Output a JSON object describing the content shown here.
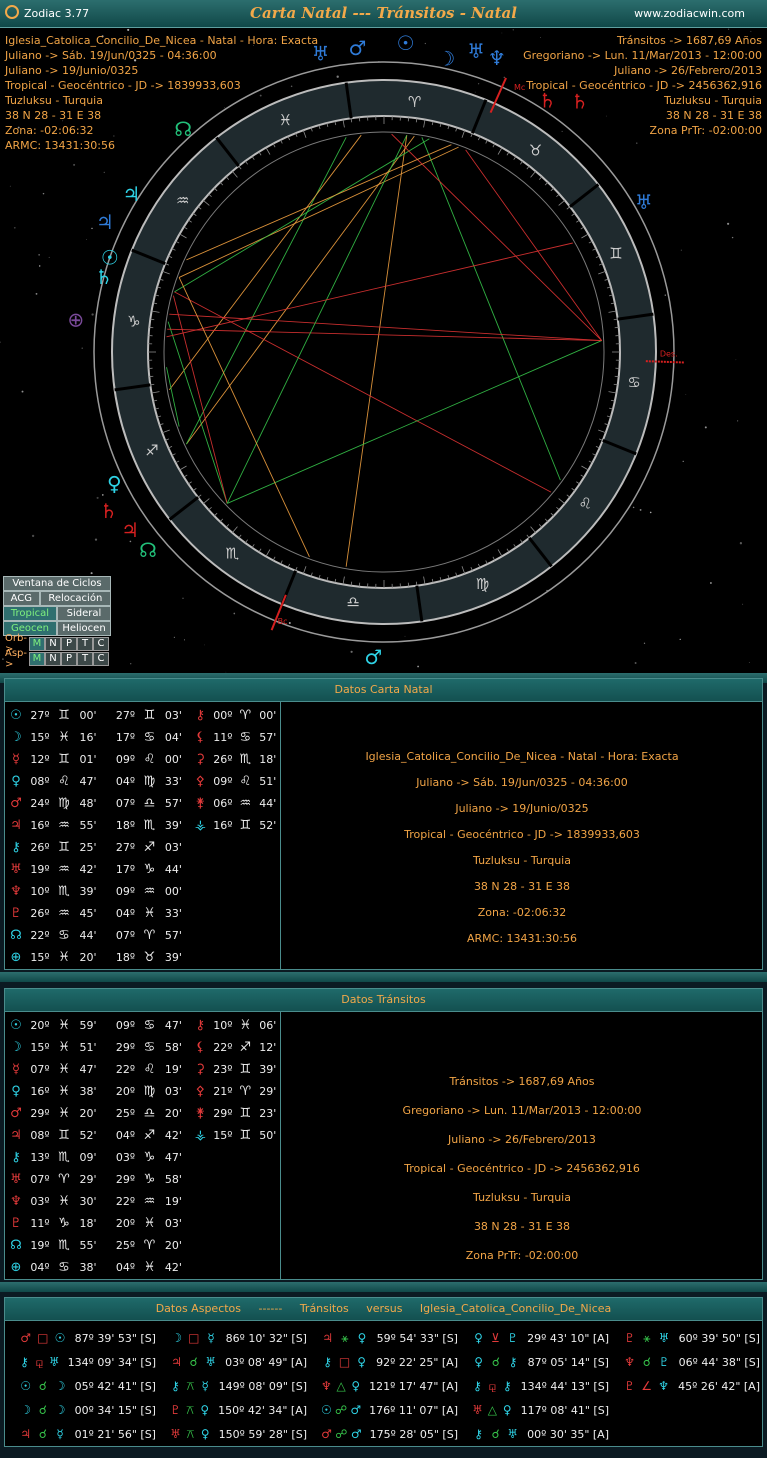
{
  "window": {
    "app_name": "Zodiac 3.77",
    "title": "Carta Natal --- Tránsitos - Natal",
    "website": "www.zodiacwin.com"
  },
  "natal_header": [
    "Iglesia_Catolica_Concilio_De_Nicea - Natal - Hora: Exacta",
    "Juliano -> Sáb. 19/Jun/0325 - 04:36:00",
    "Juliano -> 19/Junio/0325",
    "Tropical - Geocéntrico - JD -> 1839933,603",
    "Tuzluksu - Turquia",
    "38 N 28 - 31 E 38",
    "Zona: -02:06:32",
    "ARMC: 13431:30:56"
  ],
  "transit_header": [
    "Tránsitos -> 1687,69 Años",
    "Gregoriano -> Lun. 11/Mar/2013 - 12:00:00",
    "Juliano -> 26/Febrero/2013",
    "Tropical - Geocéntrico - JD -> 2456362,916",
    "Tuzluksu - Turquia",
    "38 N 28 - 31 E 38",
    "Zona PrTr: -02:00:00"
  ],
  "wheel": {
    "signs": [
      "♈",
      "♉",
      "♊",
      "♋",
      "♌",
      "♍",
      "♎",
      "♏",
      "♐",
      "♑",
      "♒",
      "♓"
    ],
    "angle_labels": {
      "mc": "Mc",
      "des": "Des.",
      "bc": "Bc"
    },
    "colors": {
      "sign_ring": "#1f2a2e",
      "ring_stroke": "#bcbcbc",
      "natal_planet": "#2fd3e6",
      "transit_planet": "#d62020",
      "blue_planet": "#2f7bd8",
      "green_planet": "#22c07a"
    },
    "transit_glyphs": [
      "♅",
      "♆",
      "♄",
      "☿",
      "♀",
      "♂",
      "☽",
      "⊕"
    ],
    "natal_glyphs": [
      "♃",
      "♅",
      "♄",
      "☉",
      "♌",
      "☊",
      "♀",
      "♆",
      "♄",
      "☊",
      "♂",
      "☽"
    ]
  },
  "controls": {
    "ventana": "Ventana de Ciclos",
    "acg": "ACG",
    "relocacion": "Relocación",
    "tropical": "Tropical",
    "sideral": "Sideral",
    "geocen": "Geocen",
    "heliocen": "Heliocen",
    "orb_label": "Orb->",
    "asp_label": "Asp->",
    "letters": [
      "M",
      "N",
      "P",
      "T",
      "C"
    ]
  },
  "natal_panel": {
    "title": "Datos Carta Natal",
    "rows": [
      [
        [
          "☉",
          "27º",
          "♊",
          "00'"
        ],
        [
          "",
          "27º",
          "♊",
          "03'"
        ],
        [
          "⚷",
          "00º",
          "♈",
          "00'"
        ]
      ],
      [
        [
          "☽",
          "15º",
          "♓",
          "16'"
        ],
        [
          "",
          "17º",
          "♋",
          "04'"
        ],
        [
          "⚸",
          "11º",
          "♋",
          "57'"
        ]
      ],
      [
        [
          "☿",
          "12º",
          "♊",
          "01'"
        ],
        [
          "",
          "09º",
          "♌",
          "00'"
        ],
        [
          "⚳",
          "26º",
          "♏",
          "18'"
        ]
      ],
      [
        [
          "♀",
          "08º",
          "♌",
          "47'"
        ],
        [
          "",
          "04º",
          "♍",
          "33'"
        ],
        [
          "⚴",
          "09º",
          "♌",
          "51'"
        ]
      ],
      [
        [
          "♂",
          "24º",
          "♍",
          "48'"
        ],
        [
          "",
          "07º",
          "♎",
          "57'"
        ],
        [
          "⚵",
          "06º",
          "♒",
          "44'"
        ]
      ],
      [
        [
          "♃",
          "16º",
          "♒",
          "55'"
        ],
        [
          "",
          "18º",
          "♏",
          "39'"
        ],
        [
          "⚶",
          "16º",
          "♊",
          "52'"
        ]
      ],
      [
        [
          "⚷",
          "26º",
          "♊",
          "25'"
        ],
        [
          "",
          "27º",
          "♐",
          "03'"
        ],
        [
          "",
          "",
          "",
          ""
        ]
      ],
      [
        [
          "♅",
          "19º",
          "♒",
          "42'"
        ],
        [
          "",
          "17º",
          "♑",
          "44'"
        ],
        [
          "",
          "",
          "",
          ""
        ]
      ],
      [
        [
          "♆",
          "10º",
          "♏",
          "39'"
        ],
        [
          "",
          "09º",
          "♒",
          "00'"
        ],
        [
          "",
          "",
          "",
          ""
        ]
      ],
      [
        [
          "♇",
          "26º",
          "♒",
          "45'"
        ],
        [
          "",
          "04º",
          "♓",
          "33'"
        ],
        [
          "",
          "",
          "",
          ""
        ]
      ],
      [
        [
          "☊",
          "22º",
          "♋",
          "44'"
        ],
        [
          "",
          "07º",
          "♈",
          "57'"
        ],
        [
          "",
          "",
          "",
          ""
        ]
      ],
      [
        [
          "⊕",
          "15º",
          "♓",
          "20'"
        ],
        [
          "",
          "18º",
          "♉",
          "39'"
        ],
        [
          "",
          "",
          "",
          ""
        ]
      ]
    ],
    "info": [
      "Iglesia_Catolica_Concilio_De_Nicea - Natal - Hora: Exacta",
      "Juliano -> Sáb. 19/Jun/0325 - 04:36:00",
      "Juliano -> 19/Junio/0325",
      "Tropical - Geocéntrico - JD -> 1839933,603",
      "Tuzluksu - Turquia",
      "38 N 28 - 31 E 38",
      "Zona: -02:06:32",
      "ARMC: 13431:30:56"
    ]
  },
  "transit_panel": {
    "title": "Datos Tránsitos",
    "rows": [
      [
        [
          "☉",
          "20º",
          "♓",
          "59'"
        ],
        [
          "",
          "09º",
          "♋",
          "47'"
        ],
        [
          "⚷",
          "10º",
          "♓",
          "06'"
        ]
      ],
      [
        [
          "☽",
          "15º",
          "♓",
          "51'"
        ],
        [
          "",
          "29º",
          "♋",
          "58'"
        ],
        [
          "⚸",
          "22º",
          "♐",
          "12'"
        ]
      ],
      [
        [
          "☿",
          "07º",
          "♓",
          "47'"
        ],
        [
          "",
          "22º",
          "♌",
          "19'"
        ],
        [
          "⚳",
          "23º",
          "♊",
          "39'"
        ]
      ],
      [
        [
          "♀",
          "16º",
          "♓",
          "38'"
        ],
        [
          "",
          "20º",
          "♍",
          "03'"
        ],
        [
          "⚴",
          "21º",
          "♈",
          "29'"
        ]
      ],
      [
        [
          "♂",
          "29º",
          "♓",
          "20'"
        ],
        [
          "",
          "25º",
          "♎",
          "20'"
        ],
        [
          "⚵",
          "29º",
          "♊",
          "23'"
        ]
      ],
      [
        [
          "♃",
          "08º",
          "♊",
          "52'"
        ],
        [
          "",
          "04º",
          "♐",
          "42'"
        ],
        [
          "⚶",
          "15º",
          "♊",
          "50'"
        ]
      ],
      [
        [
          "⚷",
          "13º",
          "♏",
          "09'"
        ],
        [
          "",
          "03º",
          "♑",
          "47'"
        ],
        [
          "",
          "",
          "",
          ""
        ]
      ],
      [
        [
          "♅",
          "07º",
          "♈",
          "29'"
        ],
        [
          "",
          "29º",
          "♑",
          "58'"
        ],
        [
          "",
          "",
          "",
          ""
        ]
      ],
      [
        [
          "♆",
          "03º",
          "♓",
          "30'"
        ],
        [
          "",
          "22º",
          "♒",
          "19'"
        ],
        [
          "",
          "",
          "",
          ""
        ]
      ],
      [
        [
          "♇",
          "11º",
          "♑",
          "18'"
        ],
        [
          "",
          "20º",
          "♓",
          "03'"
        ],
        [
          "",
          "",
          "",
          ""
        ]
      ],
      [
        [
          "☊",
          "19º",
          "♏",
          "55'"
        ],
        [
          "",
          "25º",
          "♈",
          "20'"
        ],
        [
          "",
          "",
          "",
          ""
        ]
      ],
      [
        [
          "⊕",
          "04º",
          "♋",
          "38'"
        ],
        [
          "",
          "04º",
          "♓",
          "42'"
        ],
        [
          "",
          "",
          "",
          ""
        ]
      ]
    ],
    "info": [
      "Tránsitos -> 1687,69 Años",
      "Gregoriano -> Lun. 11/Mar/2013 - 12:00:00",
      "Juliano -> 26/Febrero/2013",
      "Tropical - Geocéntrico - JD -> 2456362,916",
      "Tuzluksu - Turquia",
      "38 N 28 - 31 E 38",
      "Zona PrTr: -02:00:00"
    ]
  },
  "aspects_panel": {
    "title_parts": [
      "Datos Aspectos",
      "------",
      "Tránsitos",
      "versus",
      "Iglesia_Catolica_Concilio_De_Nicea"
    ],
    "rows": [
      [
        [
          "♂",
          "□",
          "☉",
          "87º 39' 53\" [S]"
        ],
        [
          "☽",
          "□",
          "☿",
          "86º 10' 32\" [S]"
        ],
        [
          "♃",
          "⚹",
          "♀",
          "59º 54' 33\" [S]"
        ],
        [
          "♀",
          "⊻",
          "♇",
          "29º 43' 10\" [A]"
        ],
        [
          "♇",
          "⚹",
          "♅",
          "60º 39' 50\" [S]"
        ]
      ],
      [
        [
          "⚷",
          "⚼",
          "♅",
          "134º 09' 34\" [S]"
        ],
        [
          "♃",
          "☌",
          "♅",
          "03º 08' 49\" [A]"
        ],
        [
          "⚷",
          "□",
          "♀",
          "92º 22' 25\" [A]"
        ],
        [
          "♀",
          "☌",
          "⚷",
          "87º 05' 14\" [S]"
        ],
        [
          "♆",
          "☌",
          "♇",
          "06º 44' 38\" [S]"
        ]
      ],
      [
        [
          "☉",
          "☌",
          "☽",
          "05º 42' 41\" [S]"
        ],
        [
          "⚷",
          "⚻",
          "☿",
          "149º 08' 09\" [S]"
        ],
        [
          "♆",
          "△",
          "♀",
          "121º 17' 47\" [A]"
        ],
        [
          "⚷",
          "⚼",
          "⚷",
          "134º 44' 13\" [S]"
        ],
        [
          "♇",
          "∠",
          "♆",
          "45º 26' 42\" [A]"
        ]
      ],
      [
        [
          "☽",
          "☌",
          "☽",
          "00º 34' 15\" [S]"
        ],
        [
          "♇",
          "⚻",
          "♀",
          "150º 42' 34\" [A]"
        ],
        [
          "☉",
          "☍",
          "♂",
          "176º 11' 07\" [A]"
        ],
        [
          "♅",
          "△",
          "♀",
          "117º 08' 41\" [S]"
        ],
        [
          "",
          "",
          "",
          ""
        ]
      ],
      [
        [
          "♃",
          "☌",
          "☿",
          "01º 21' 56\" [S]"
        ],
        [
          "♅",
          "⚻",
          "♀",
          "150º 59' 28\" [S]"
        ],
        [
          "♂",
          "☍",
          "♂",
          "175º 28' 05\" [S]"
        ],
        [
          "⚷",
          "☌",
          "♅",
          "00º 30' 35\" [A]"
        ],
        [
          "",
          "",
          "",
          ""
        ]
      ]
    ]
  }
}
